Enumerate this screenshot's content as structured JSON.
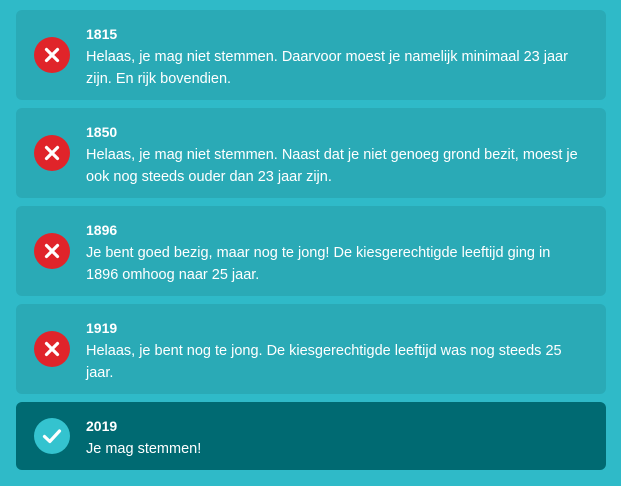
{
  "items": [
    {
      "year": "1815",
      "status": "fail",
      "icon": "close-icon",
      "message": "Helaas, je mag niet stemmen. Daarvoor moest je namelijk minimaal 23 jaar zijn. En rijk bovendien."
    },
    {
      "year": "1850",
      "status": "fail",
      "icon": "close-icon",
      "message": "Helaas, je mag niet stemmen. Naast dat je niet genoeg grond bezit, moest je ook nog steeds ouder dan 23 jaar zijn."
    },
    {
      "year": "1896",
      "status": "fail",
      "icon": "close-icon",
      "message": "Je bent goed bezig, maar nog te jong! De kiesgerechtigde leeftijd ging in 1896 omhoog naar 25 jaar."
    },
    {
      "year": "1919",
      "status": "fail",
      "icon": "close-icon",
      "message": "Helaas, je bent nog te jong. De kiesgerechtigde leeftijd was nog steeds 25 jaar."
    },
    {
      "year": "2019",
      "status": "pass",
      "icon": "check-icon",
      "message": "Je mag stemmen!"
    }
  ],
  "colors": {
    "background": "#2fbac8",
    "card": "#2aaab6",
    "card_success": "#006a72",
    "fail": "#e0242a",
    "pass": "#34c3cf"
  }
}
